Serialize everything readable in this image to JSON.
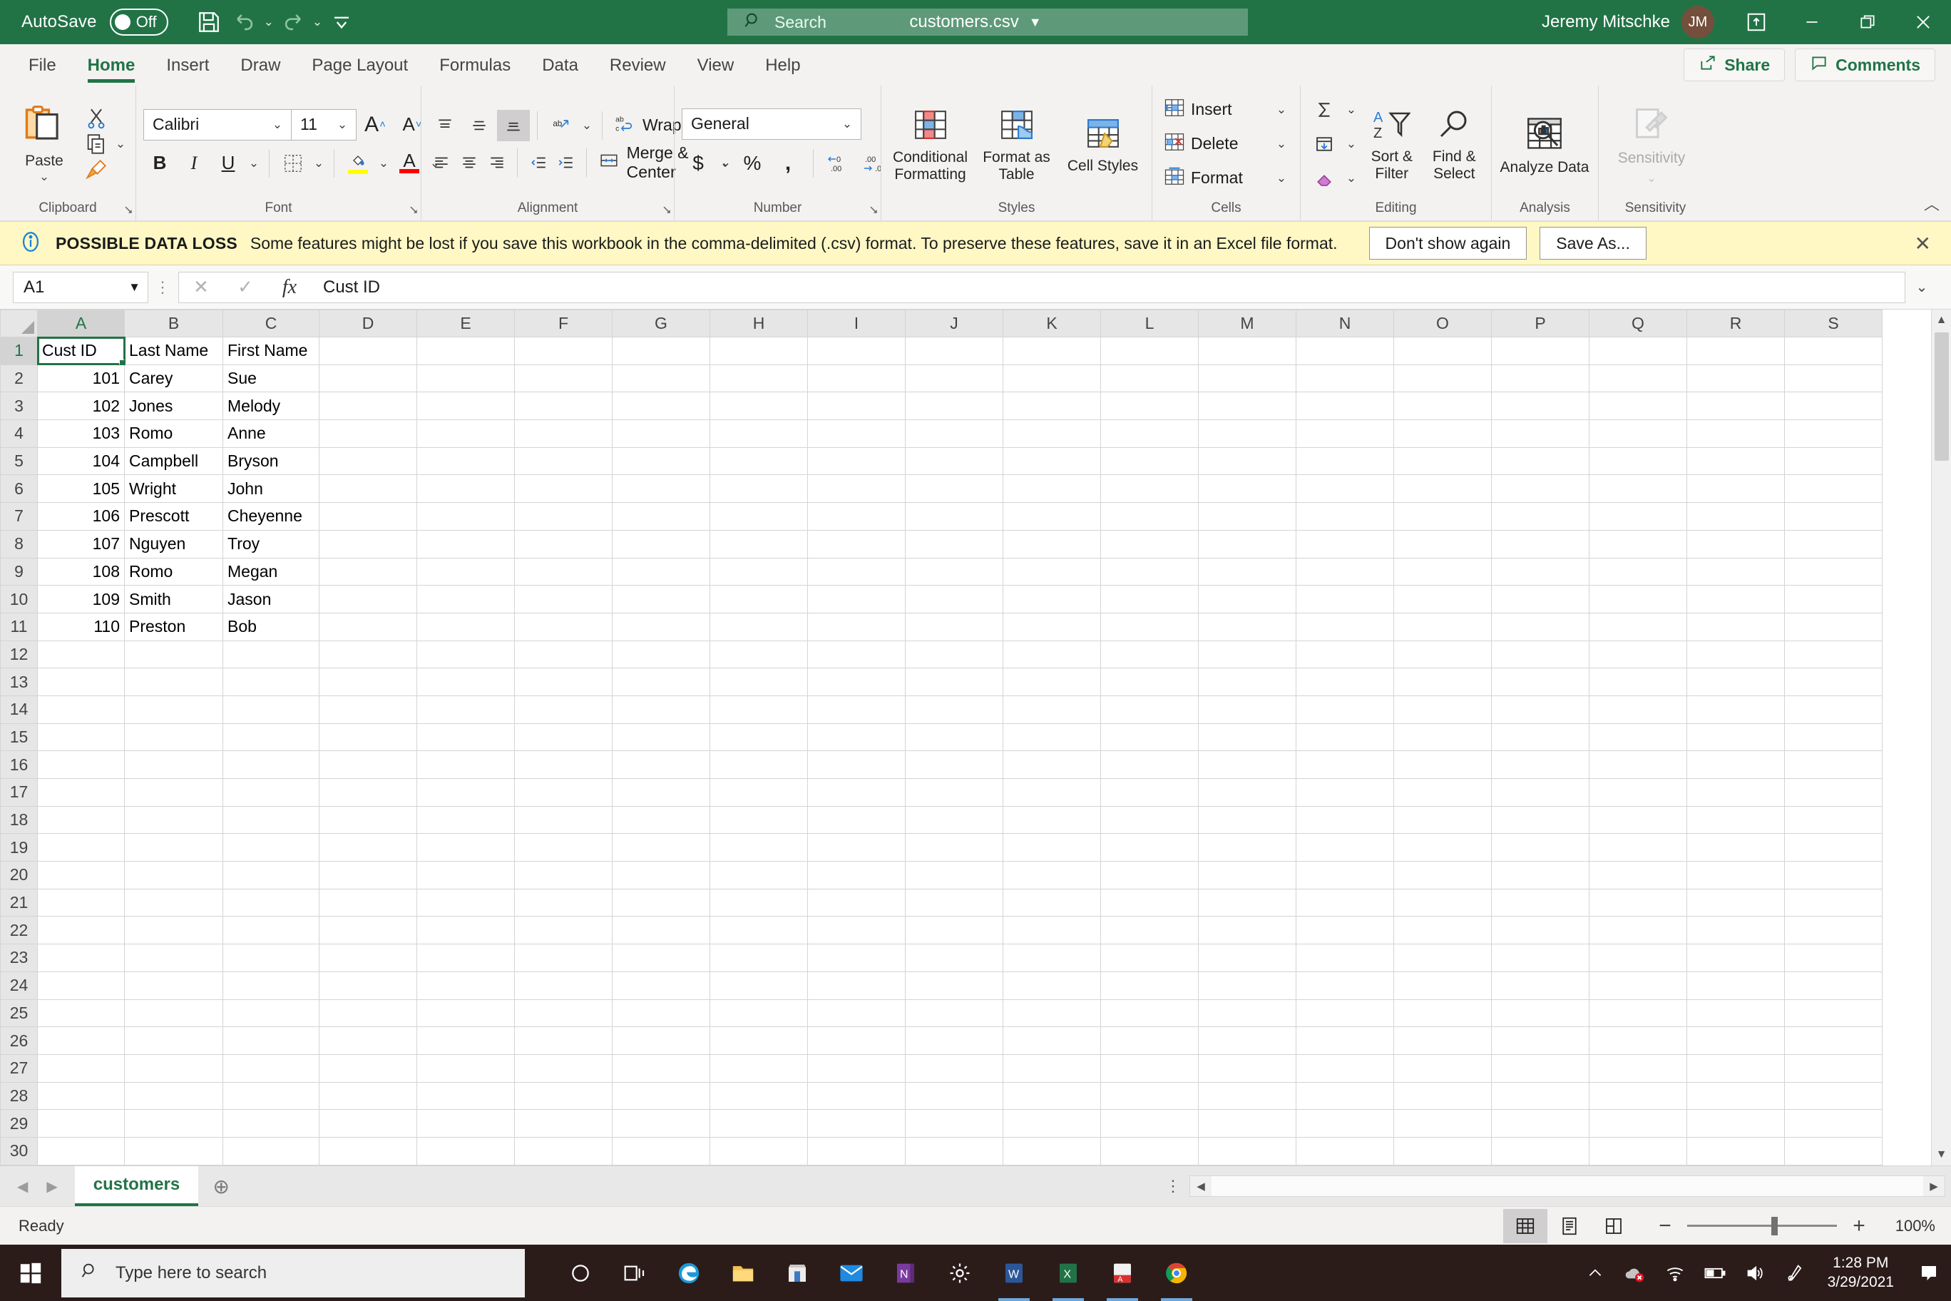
{
  "titlebar": {
    "autosave_label": "AutoSave",
    "autosave_state": "Off",
    "save_icon": "save-icon",
    "undo_icon": "undo-icon",
    "redo_icon": "redo-icon",
    "qat_more_icon": "quick-access-more-icon",
    "document_name": "customers.csv",
    "document_dropdown_icon": "chevron-down-icon",
    "search_icon": "search-icon",
    "search_placeholder": "Search",
    "user_name": "Jeremy Mitschke",
    "user_initials": "JM",
    "ribbon_display_icon": "ribbon-display-options-icon",
    "minimize_icon": "minimize-icon",
    "restore_icon": "restore-icon",
    "close_icon": "close-icon",
    "brand_color": "#217346"
  },
  "ribbon_tabs": [
    {
      "label": "File",
      "active": false
    },
    {
      "label": "Home",
      "active": true
    },
    {
      "label": "Insert",
      "active": false
    },
    {
      "label": "Draw",
      "active": false
    },
    {
      "label": "Page Layout",
      "active": false
    },
    {
      "label": "Formulas",
      "active": false
    },
    {
      "label": "Data",
      "active": false
    },
    {
      "label": "Review",
      "active": false
    },
    {
      "label": "View",
      "active": false
    },
    {
      "label": "Help",
      "active": false
    }
  ],
  "ribbon_right": {
    "share_label": "Share",
    "share_icon": "share-icon",
    "comments_label": "Comments",
    "comments_icon": "comment-icon"
  },
  "ribbon": {
    "clipboard": {
      "group_label": "Clipboard",
      "paste_label": "Paste",
      "paste_icon": "paste-icon",
      "cut_icon": "scissors-icon",
      "copy_icon": "copy-icon",
      "format_painter_icon": "format-painter-icon",
      "dialog_launcher_icon": "dialog-launcher-icon"
    },
    "font": {
      "group_label": "Font",
      "font_name": "Calibri",
      "font_size": "11",
      "grow_font_icon": "grow-font-icon",
      "shrink_font_icon": "shrink-font-icon",
      "bold_label": "B",
      "italic_label": "I",
      "underline_label": "U",
      "borders_icon": "borders-icon",
      "fill_color_icon": "fill-color-icon",
      "font_color_icon": "font-color-icon",
      "fill_color": "#ffff00",
      "font_color": "#ff0000",
      "dialog_launcher_icon": "dialog-launcher-icon"
    },
    "alignment": {
      "group_label": "Alignment",
      "align_top_icon": "align-top-icon",
      "align_middle_icon": "align-middle-icon",
      "align_bottom_icon": "align-bottom-icon",
      "orientation_icon": "text-orientation-icon",
      "wrap_text_label": "Wrap Text",
      "wrap_text_icon": "wrap-text-icon",
      "align_left_icon": "align-left-icon",
      "align_center_icon": "align-center-icon",
      "align_right_icon": "align-right-icon",
      "decrease_indent_icon": "decrease-indent-icon",
      "increase_indent_icon": "increase-indent-icon",
      "merge_center_label": "Merge & Center",
      "merge_center_icon": "merge-center-icon",
      "dialog_launcher_icon": "dialog-launcher-icon"
    },
    "number": {
      "group_label": "Number",
      "format": "General",
      "accounting_icon": "currency-icon",
      "percent_icon": "percent-icon",
      "comma_icon": "comma-style-icon",
      "increase_decimal_icon": "increase-decimal-icon",
      "decrease_decimal_icon": "decrease-decimal-icon",
      "dialog_launcher_icon": "dialog-launcher-icon"
    },
    "styles": {
      "group_label": "Styles",
      "conditional_formatting_label": "Conditional Formatting",
      "conditional_formatting_icon": "conditional-formatting-icon",
      "format_as_table_label": "Format as Table",
      "format_as_table_icon": "format-as-table-icon",
      "cell_styles_label": "Cell Styles",
      "cell_styles_icon": "cell-styles-icon"
    },
    "cells": {
      "group_label": "Cells",
      "insert_label": "Insert",
      "insert_icon": "insert-cells-icon",
      "delete_label": "Delete",
      "delete_icon": "delete-cells-icon",
      "format_label": "Format",
      "format_icon": "format-cells-icon"
    },
    "editing": {
      "group_label": "Editing",
      "autosum_icon": "autosum-icon",
      "fill_icon": "fill-down-icon",
      "clear_icon": "clear-eraser-icon",
      "sort_filter_label": "Sort & Filter",
      "sort_filter_icon": "sort-filter-icon",
      "find_select_label": "Find & Select",
      "find_select_icon": "find-select-icon"
    },
    "analysis": {
      "group_label": "Analysis",
      "analyze_data_label": "Analyze Data",
      "analyze_data_icon": "analyze-data-icon"
    },
    "sensitivity": {
      "group_label": "Sensitivity",
      "sensitivity_label": "Sensitivity",
      "sensitivity_icon": "sensitivity-icon"
    },
    "collapse_icon": "collapse-ribbon-icon"
  },
  "message_bar": {
    "info_icon": "info-icon",
    "title": "POSSIBLE DATA LOSS",
    "text": "Some features might be lost if you save this workbook in the comma-delimited (.csv) format. To preserve these features, save it in an Excel file format.",
    "dont_show_label": "Don't show again",
    "save_as_label": "Save As...",
    "close_icon": "close-icon",
    "background": "#fff8c4"
  },
  "formula_bar": {
    "name_box": "A1",
    "name_box_dropdown_icon": "chevron-down-icon",
    "cancel_icon": "cancel-icon",
    "enter_icon": "enter-check-icon",
    "function_icon": "insert-function-icon",
    "formula_value": "Cust ID",
    "expand_icon": "expand-formula-bar-icon"
  },
  "grid": {
    "columns": [
      "A",
      "B",
      "C",
      "D",
      "E",
      "F",
      "G",
      "H",
      "I",
      "J",
      "K",
      "L",
      "M",
      "N",
      "O",
      "P",
      "Q",
      "R",
      "S"
    ],
    "selected_column": "A",
    "selected_row": 1,
    "active_cell": "A1",
    "row_count": 30,
    "rows": [
      {
        "n": 1,
        "a": "Cust ID",
        "b": "Last Name",
        "c": "First Name",
        "a_numeric": false
      },
      {
        "n": 2,
        "a": "101",
        "b": "Carey",
        "c": "Sue",
        "a_numeric": true
      },
      {
        "n": 3,
        "a": "102",
        "b": "Jones",
        "c": "Melody",
        "a_numeric": true
      },
      {
        "n": 4,
        "a": "103",
        "b": "Romo",
        "c": "Anne",
        "a_numeric": true
      },
      {
        "n": 5,
        "a": "104",
        "b": "Campbell",
        "c": "Bryson",
        "a_numeric": true
      },
      {
        "n": 6,
        "a": "105",
        "b": "Wright",
        "c": "John",
        "a_numeric": true
      },
      {
        "n": 7,
        "a": "106",
        "b": "Prescott",
        "c": "Cheyenne",
        "a_numeric": true
      },
      {
        "n": 8,
        "a": "107",
        "b": "Nguyen",
        "c": "Troy",
        "a_numeric": true
      },
      {
        "n": 9,
        "a": "108",
        "b": "Romo",
        "c": "Megan",
        "a_numeric": true
      },
      {
        "n": 10,
        "a": "109",
        "b": "Smith",
        "c": "Jason",
        "a_numeric": true
      },
      {
        "n": 11,
        "a": "110",
        "b": "Preston",
        "c": "Bob",
        "a_numeric": true
      },
      {
        "n": 12,
        "a": "",
        "b": "",
        "c": "",
        "a_numeric": false
      },
      {
        "n": 13,
        "a": "",
        "b": "",
        "c": "",
        "a_numeric": false
      },
      {
        "n": 14,
        "a": "",
        "b": "",
        "c": "",
        "a_numeric": false
      },
      {
        "n": 15,
        "a": "",
        "b": "",
        "c": "",
        "a_numeric": false
      },
      {
        "n": 16,
        "a": "",
        "b": "",
        "c": "",
        "a_numeric": false
      },
      {
        "n": 17,
        "a": "",
        "b": "",
        "c": "",
        "a_numeric": false
      },
      {
        "n": 18,
        "a": "",
        "b": "",
        "c": "",
        "a_numeric": false
      },
      {
        "n": 19,
        "a": "",
        "b": "",
        "c": "",
        "a_numeric": false
      },
      {
        "n": 20,
        "a": "",
        "b": "",
        "c": "",
        "a_numeric": false
      },
      {
        "n": 21,
        "a": "",
        "b": "",
        "c": "",
        "a_numeric": false
      },
      {
        "n": 22,
        "a": "",
        "b": "",
        "c": "",
        "a_numeric": false
      },
      {
        "n": 23,
        "a": "",
        "b": "",
        "c": "",
        "a_numeric": false
      },
      {
        "n": 24,
        "a": "",
        "b": "",
        "c": "",
        "a_numeric": false
      },
      {
        "n": 25,
        "a": "",
        "b": "",
        "c": "",
        "a_numeric": false
      },
      {
        "n": 26,
        "a": "",
        "b": "",
        "c": "",
        "a_numeric": false
      },
      {
        "n": 27,
        "a": "",
        "b": "",
        "c": "",
        "a_numeric": false
      },
      {
        "n": 28,
        "a": "",
        "b": "",
        "c": "",
        "a_numeric": false
      },
      {
        "n": 29,
        "a": "",
        "b": "",
        "c": "",
        "a_numeric": false
      },
      {
        "n": 30,
        "a": "",
        "b": "",
        "c": "",
        "a_numeric": false
      }
    ]
  },
  "sheet_tabs": {
    "prev_icon": "previous-sheet-icon",
    "next_icon": "next-sheet-icon",
    "tabs": [
      {
        "label": "customers",
        "active": true
      }
    ],
    "add_sheet_icon": "add-sheet-icon"
  },
  "status_bar": {
    "status": "Ready",
    "normal_view_icon": "normal-view-icon",
    "page_layout_icon": "page-layout-view-icon",
    "page_break_icon": "page-break-preview-icon",
    "zoom_out_label": "−",
    "zoom_in_label": "+",
    "zoom_level": "100%"
  },
  "taskbar": {
    "start_icon": "windows-start-icon",
    "search_icon": "search-icon",
    "search_placeholder": "Type here to search",
    "items": [
      {
        "icon": "cortana-icon",
        "running": false
      },
      {
        "icon": "task-view-icon",
        "running": false
      },
      {
        "icon": "microsoft-edge-icon",
        "running": false
      },
      {
        "icon": "file-explorer-icon",
        "running": false
      },
      {
        "icon": "microsoft-store-icon",
        "running": false
      },
      {
        "icon": "mail-icon",
        "running": false
      },
      {
        "icon": "onenote-icon",
        "running": false
      },
      {
        "icon": "settings-icon",
        "running": false
      },
      {
        "icon": "microsoft-word-icon",
        "running": true
      },
      {
        "icon": "microsoft-excel-icon",
        "running": true
      },
      {
        "icon": "adobe-acrobat-icon",
        "running": true
      },
      {
        "icon": "google-chrome-icon",
        "running": true
      }
    ],
    "tray": [
      {
        "icon": "show-hidden-icons-icon"
      },
      {
        "icon": "onedrive-error-icon"
      },
      {
        "icon": "wifi-icon"
      },
      {
        "icon": "battery-icon"
      },
      {
        "icon": "volume-icon"
      },
      {
        "icon": "pen-menu-icon"
      }
    ],
    "time": "1:28 PM",
    "date": "3/29/2021",
    "notification_icon": "notification-center-icon"
  }
}
